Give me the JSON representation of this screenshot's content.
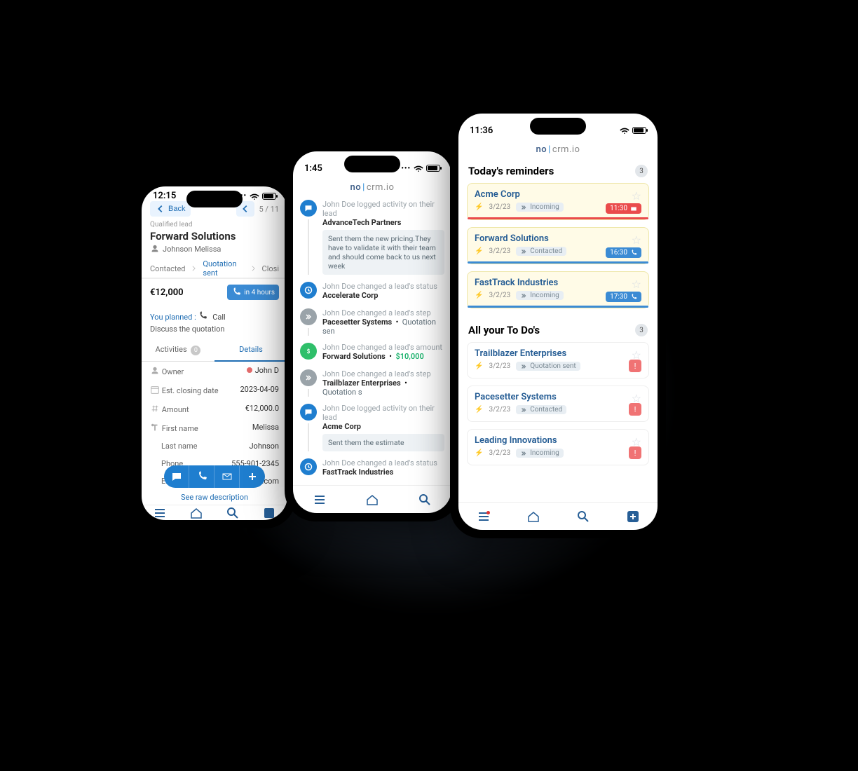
{
  "brand": {
    "a": "no",
    "b": "crm.io"
  },
  "phoneA": {
    "time": "12:15",
    "back": "Back",
    "pager": "5 / 11",
    "qualified": "Qualified lead",
    "leadTitle": "Forward Solutions",
    "contact": "Johnson Melissa",
    "steps": {
      "prev": "Contacted",
      "active": "Quotation sent",
      "next": "Closi"
    },
    "amount": "€12,000",
    "reminder": "in 4 hours",
    "planned": "You planned :",
    "plannedAction": "Call",
    "discuss": "Discuss the quotation",
    "tabs": {
      "activities": "Activities",
      "activitiesCount": "0",
      "details": "Details"
    },
    "details": {
      "ownerLabel": "Owner",
      "ownerValue": "John D",
      "closingLabel": "Est. closing date",
      "closingValue": "2023-04-09",
      "amountLabel": "Amount",
      "amountValue": "€12,000.0",
      "firstLabel": "First name",
      "firstValue": "Melissa",
      "lastLabel": "Last name",
      "lastValue": "Johnson",
      "phoneLabel": "Phone",
      "phoneValue": "555-901-2345",
      "emailLabel": "Email",
      "emailValue": "ions.com"
    },
    "rawLink": "See raw description"
  },
  "phoneB": {
    "time": "1:45",
    "feed": [
      {
        "icon": "chat",
        "who": "John Doe logged activity on their lead",
        "lead": "AdvanceTech Partners",
        "note": "Sent them the new pricing.They have to validate it with their team and should come back to us next week"
      },
      {
        "icon": "clock",
        "who": "John Doe changed a lead's status",
        "lead": "Accelerate Corp"
      },
      {
        "icon": "fwd",
        "who": "John Doe changed a lead's step",
        "lead": "Pacesetter Systems",
        "step": "Quotation sen"
      },
      {
        "icon": "money",
        "who": "John Doe changed a lead's amount",
        "lead": "Forward Solutions",
        "amount": "$10,000"
      },
      {
        "icon": "fwd",
        "who": "John Doe changed a lead's step",
        "lead": "Trailblazer Enterprises",
        "step": "Quotation s"
      },
      {
        "icon": "chat",
        "who": "John Doe logged activity on their lead",
        "lead": "Acme Corp",
        "note": "Sent them the estimate"
      },
      {
        "icon": "clock",
        "who": "John Doe changed a lead's status",
        "lead": "FastTrack Industries"
      }
    ]
  },
  "phoneC": {
    "time": "11:36",
    "remindersTitle": "Today's reminders",
    "remindersCount": "3",
    "todosTitle": "All your To Do's",
    "todosCount": "3",
    "reminders": [
      {
        "name": "Acme Corp",
        "date": "3/2/23",
        "step": "Incoming",
        "time": "11:30",
        "color": "red"
      },
      {
        "name": "Forward Solutions",
        "date": "3/2/23",
        "step": "Contacted",
        "time": "16:30",
        "color": "blue"
      },
      {
        "name": "FastTrack Industries",
        "date": "3/2/23",
        "step": "Incoming",
        "time": "17:30",
        "color": "blue"
      }
    ],
    "todos": [
      {
        "name": "Trailblazer Enterprises",
        "date": "3/2/23",
        "step": "Quotation sent"
      },
      {
        "name": "Pacesetter Systems",
        "date": "3/2/23",
        "step": "Contacted"
      },
      {
        "name": "Leading Innovations",
        "date": "3/2/23",
        "step": "Incoming"
      }
    ]
  }
}
